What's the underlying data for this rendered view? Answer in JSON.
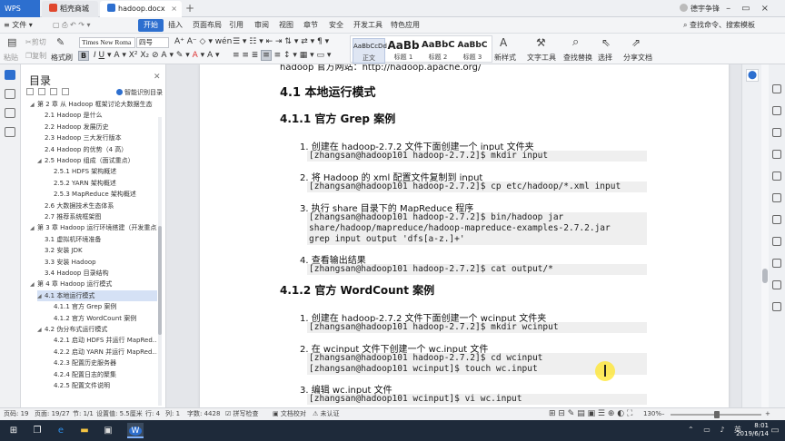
{
  "titlebar": {
    "brand": "WPS",
    "tabs": [
      {
        "label": "稻壳商城",
        "icon": "docer-icon",
        "color": "#e0472d"
      },
      {
        "label": "hadoop.docx",
        "icon": "word-doc-icon",
        "color": "#2d6fcf"
      }
    ],
    "user": "德宇争锋"
  },
  "menubar": {
    "file": "文件",
    "items": [
      "开始",
      "插入",
      "页面布局",
      "引用",
      "审阅",
      "视图",
      "章节",
      "安全",
      "开发工具",
      "特色应用"
    ],
    "active": "开始",
    "search": "查找命令、搜索模板"
  },
  "ribbon": {
    "paste": "粘贴",
    "cut": "剪切",
    "copy": "复制",
    "format_painter": "格式刷",
    "font_name": "Times New Roma",
    "font_size": "四号",
    "styles": [
      {
        "preview": "AaBbCcDd",
        "name": "正文"
      },
      {
        "preview": "AaBb",
        "name": "标题 1"
      },
      {
        "preview": "AaBbC",
        "name": "标题 2"
      },
      {
        "preview": "AaBbC",
        "name": "标题 3"
      }
    ],
    "new_style": "新样式",
    "text_tools": "文字工具",
    "find_replace": "查找替换",
    "select": "选择",
    "share": "分享文档"
  },
  "toc": {
    "title": "目录",
    "smart": "智能识别目录",
    "items": [
      {
        "level": 1,
        "label": "第 2 章 从 Hadoop 框架讨论大数据生态",
        "arrow": "◢"
      },
      {
        "level": 2,
        "label": "2.1 Hadoop 是什么"
      },
      {
        "level": 2,
        "label": "2.2 Hadoop 发展历史"
      },
      {
        "level": 2,
        "label": "2.3 Hadoop 三大发行版本"
      },
      {
        "level": 2,
        "label": "2.4 Hadoop 的优势（4 高）"
      },
      {
        "level": 2,
        "label": "2.5 Hadoop 组成（面试重点）",
        "arrow": "◢"
      },
      {
        "level": 3,
        "label": "2.5.1 HDFS 架构概述"
      },
      {
        "level": 3,
        "label": "2.5.2 YARN 架构概述"
      },
      {
        "level": 3,
        "label": "2.5.3 MapReduce 架构概述"
      },
      {
        "level": 2,
        "label": "2.6 大数据技术生态体系"
      },
      {
        "level": 2,
        "label": "2.7 推荐系统框架图"
      },
      {
        "level": 1,
        "label": "第 3 章 Hadoop 运行环境搭建（开发重点）",
        "arrow": "◢"
      },
      {
        "level": 2,
        "label": "3.1 虚拟机环境准备"
      },
      {
        "level": 2,
        "label": "3.2 安装 JDK"
      },
      {
        "level": 2,
        "label": "3.3 安装 Hadoop"
      },
      {
        "level": 2,
        "label": "3.4 Hadoop 目录结构"
      },
      {
        "level": 1,
        "label": "第 4 章 Hadoop 运行模式",
        "arrow": "◢"
      },
      {
        "level": 2,
        "label": "4.1 本地运行模式",
        "arrow": "◢",
        "selected": true
      },
      {
        "level": 3,
        "label": "4.1.1 官方 Grep 案例"
      },
      {
        "level": 3,
        "label": "4.1.2 官方 WordCount 案例"
      },
      {
        "level": 2,
        "label": "4.2 伪分布式运行模式",
        "arrow": "◢"
      },
      {
        "level": 3,
        "label": "4.2.1 启动 HDFS 并运行 MapRed…"
      },
      {
        "level": 3,
        "label": "4.2.2 启动 YARN 并运行 MapRed…"
      },
      {
        "level": 3,
        "label": "4.2.3 配置历史服务器"
      },
      {
        "level": 3,
        "label": "4.2.4 配置日志的聚集"
      },
      {
        "level": 3,
        "label": "4.2.5 配置文件说明"
      }
    ]
  },
  "doc": {
    "top_fragment": "hadoop 官方网站：http://hadoop.apache.org/",
    "h2": "4.1 本地运行模式",
    "sections": [
      {
        "heading": "4.1.1 官方 Grep 案例",
        "steps": [
          {
            "text": "1.   创建在 hadoop-2.7.2 文件下面创建一个 input 文件夹",
            "code": "[zhangsan@hadoop101 hadoop-2.7.2]$ mkdir input"
          },
          {
            "text": "2.   将 Hadoop 的 xml 配置文件复制到 input",
            "code": "[zhangsan@hadoop101 hadoop-2.7.2]$ cp etc/hadoop/*.xml input"
          },
          {
            "text": "3.   执行 share 目录下的 MapReduce 程序",
            "code": "[zhangsan@hadoop101 hadoop-2.7.2]$ bin/hadoop jar\nshare/hadoop/mapreduce/hadoop-mapreduce-examples-2.7.2.jar\ngrep input output 'dfs[a-z.]+'"
          },
          {
            "text": "4.   查看输出结果",
            "code": "[zhangsan@hadoop101 hadoop-2.7.2]$ cat output/*"
          }
        ]
      },
      {
        "heading": "4.1.2 官方 WordCount 案例",
        "steps": [
          {
            "text": "1.   创建在 hadoop-2.7.2 文件下面创建一个 wcinput 文件夹",
            "code": "[zhangsan@hadoop101 hadoop-2.7.2]$ mkdir wcinput"
          },
          {
            "text": "2.   在 wcinput 文件下创建一个 wc.input 文件",
            "code": "[zhangsan@hadoop101 hadoop-2.7.2]$ cd wcinput\n[zhangsan@hadoop101 wcinput]$ touch wc.input"
          },
          {
            "text": "3.   编辑 wc.input 文件",
            "code": "[zhangsan@hadoop101 wcinput]$ vi wc.input"
          }
        ]
      }
    ]
  },
  "status": {
    "page_no": "页码: 19",
    "pages": "页面: 19/27",
    "section": "节: 1/1",
    "settings": "设置值: 5.5厘米",
    "row": "行: 4",
    "col": "列: 1",
    "words": "字数: 4428",
    "spell": "拼写检查",
    "proof": "文档校对",
    "cert": "未认证",
    "zoom": "130%"
  },
  "taskbar": {
    "time": "8:01",
    "date": "2019/6/14",
    "lang": "英"
  },
  "colors": {
    "accent": "#2d6fcf",
    "taskbar": "#1e2a3a"
  }
}
